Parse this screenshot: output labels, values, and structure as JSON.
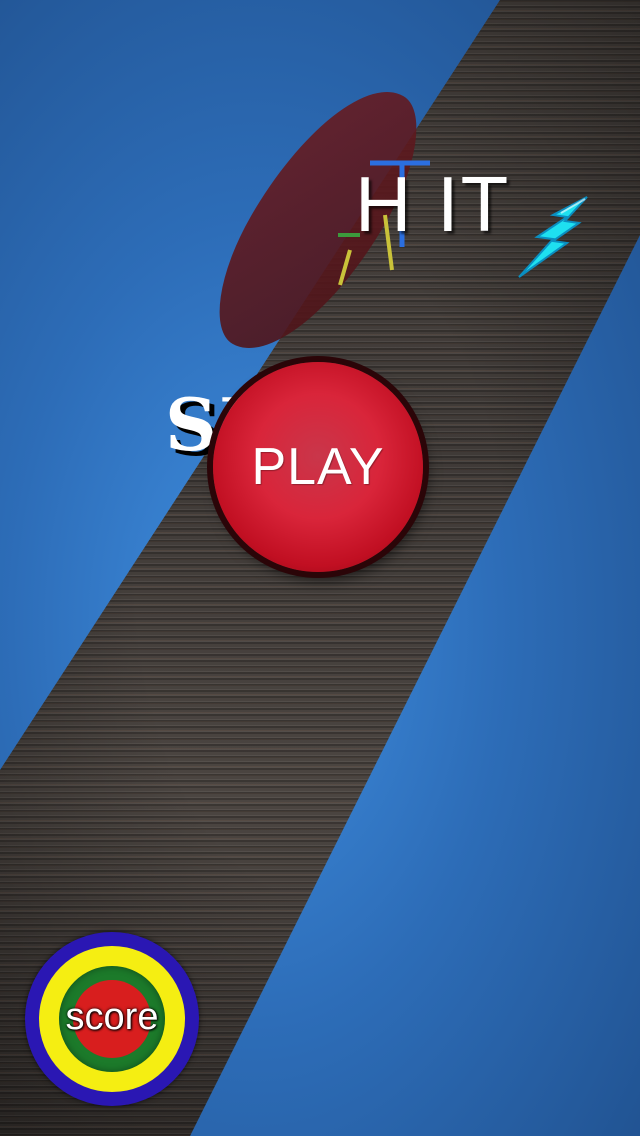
{
  "game": {
    "title_fragment_right": "H IT",
    "title_fragment_left": "SI",
    "play_label": "PLAY",
    "score_label": "score"
  },
  "colors": {
    "background_blue": "#2d6db8",
    "wood_brown": "#433d39",
    "play_red": "#d9253a",
    "score_outer_blue": "#2a17b3",
    "score_yellow": "#f5ee12",
    "score_green": "#1c7a2a",
    "score_red": "#d81e1e",
    "bolt_cyan": "#1ee0f0"
  },
  "icons": {
    "bolt": "lightning-bolt-icon",
    "sticks": "falling-sticks-icon"
  }
}
